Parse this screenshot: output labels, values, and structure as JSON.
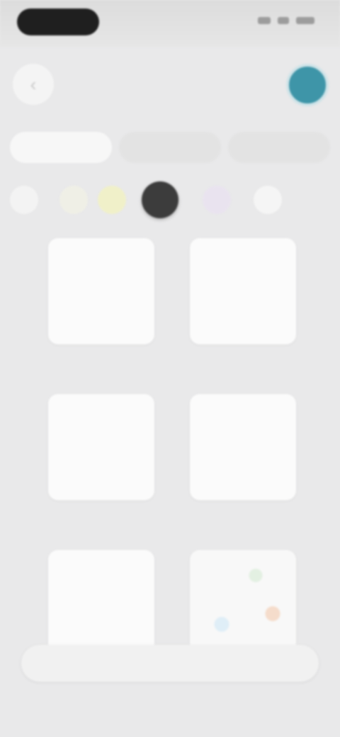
{
  "header": {
    "back_icon": "chevron-left-icon",
    "back_glyph": "‹",
    "title": ""
  },
  "tabs": [
    {
      "label": ""
    },
    {
      "label": ""
    },
    {
      "label": ""
    }
  ],
  "swatches": [
    {
      "color": "#f3f3f3"
    },
    {
      "color": "#efefe6"
    },
    {
      "color": "#f0f0c9"
    },
    {
      "color": "#3c3c3c",
      "selected": true
    },
    {
      "color": "#e9e3ef"
    },
    {
      "color": "#f5f5f5"
    }
  ],
  "grid": [
    {
      "label": ""
    },
    {
      "label": ""
    },
    {
      "label": ""
    },
    {
      "label": ""
    },
    {
      "label": ""
    },
    {
      "label": ""
    }
  ],
  "bottom_bar": {
    "left_label": "",
    "right_label": ""
  },
  "colors": {
    "accent": "#3e95a8",
    "background": "#e9e9ea"
  }
}
